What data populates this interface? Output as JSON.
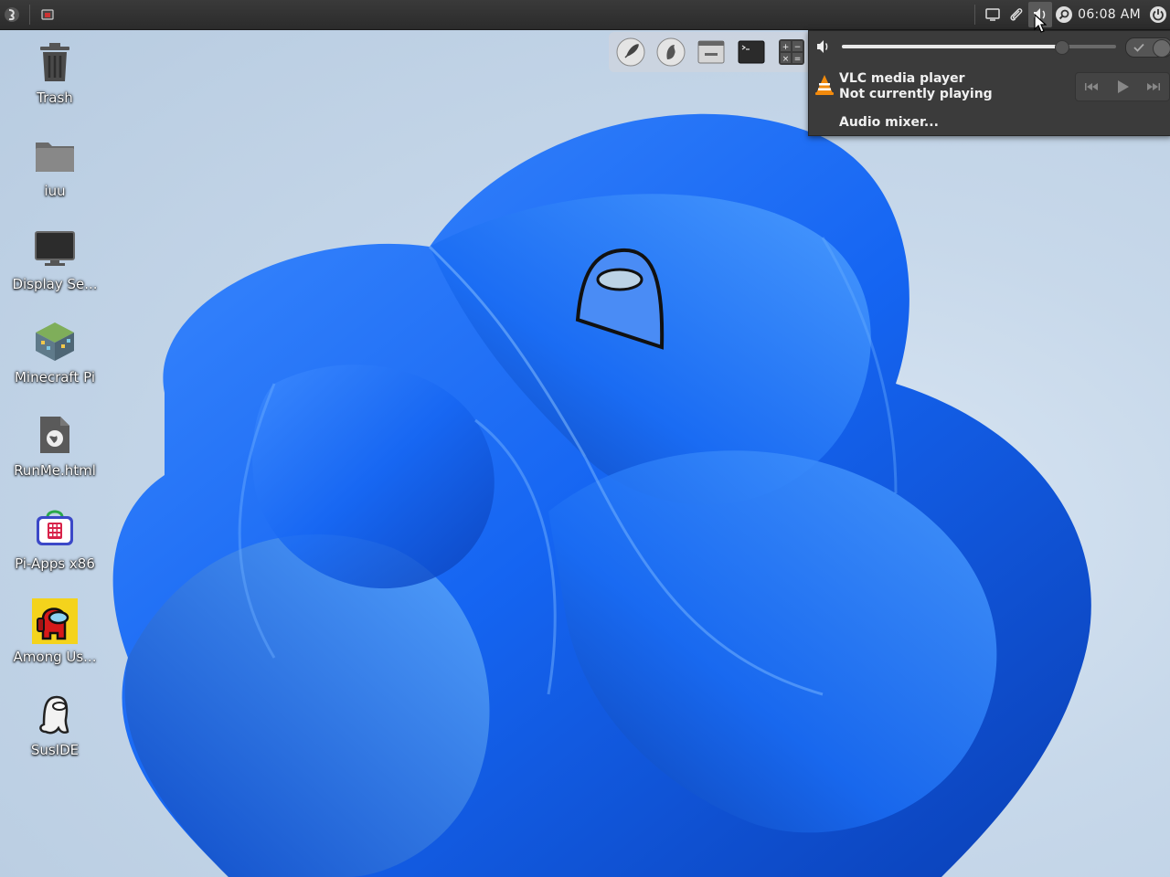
{
  "panel": {
    "left_icons": [
      "app-menu-icon",
      "window-list-icon"
    ],
    "tray_icons": [
      "display-icon",
      "paperclip-icon",
      "speaker-icon",
      "search-icon"
    ],
    "clock": "06:08 AM",
    "power_icon": "power-icon"
  },
  "dock": {
    "items": [
      "launcher-rocket-icon",
      "file-manager-icon",
      "window-manager-icon",
      "terminal-icon",
      "calculator-icon"
    ]
  },
  "desktop": {
    "icons": [
      {
        "label": "Trash",
        "icon": "trash-icon"
      },
      {
        "label": "iuu",
        "icon": "folder-icon"
      },
      {
        "label": "Display Se...",
        "icon": "monitor-icon"
      },
      {
        "label": "Minecraft Pi",
        "icon": "minecraft-icon"
      },
      {
        "label": "RunMe.html",
        "icon": "html-file-icon"
      },
      {
        "label": "Pi-Apps x86",
        "icon": "pi-apps-icon"
      },
      {
        "label": "Among Us...",
        "icon": "among-us-icon"
      },
      {
        "label": "SusIDE",
        "icon": "suside-icon"
      }
    ]
  },
  "sound_menu": {
    "volume_percent": 80,
    "muted": false,
    "player_name": "VLC media player",
    "player_status": "Not currently playing",
    "mixer_label": "Audio mixer...",
    "colors": {
      "accent": "#e8e8e8",
      "background": "#3b3b3b",
      "vlc_orange": "#f28a0c"
    }
  }
}
